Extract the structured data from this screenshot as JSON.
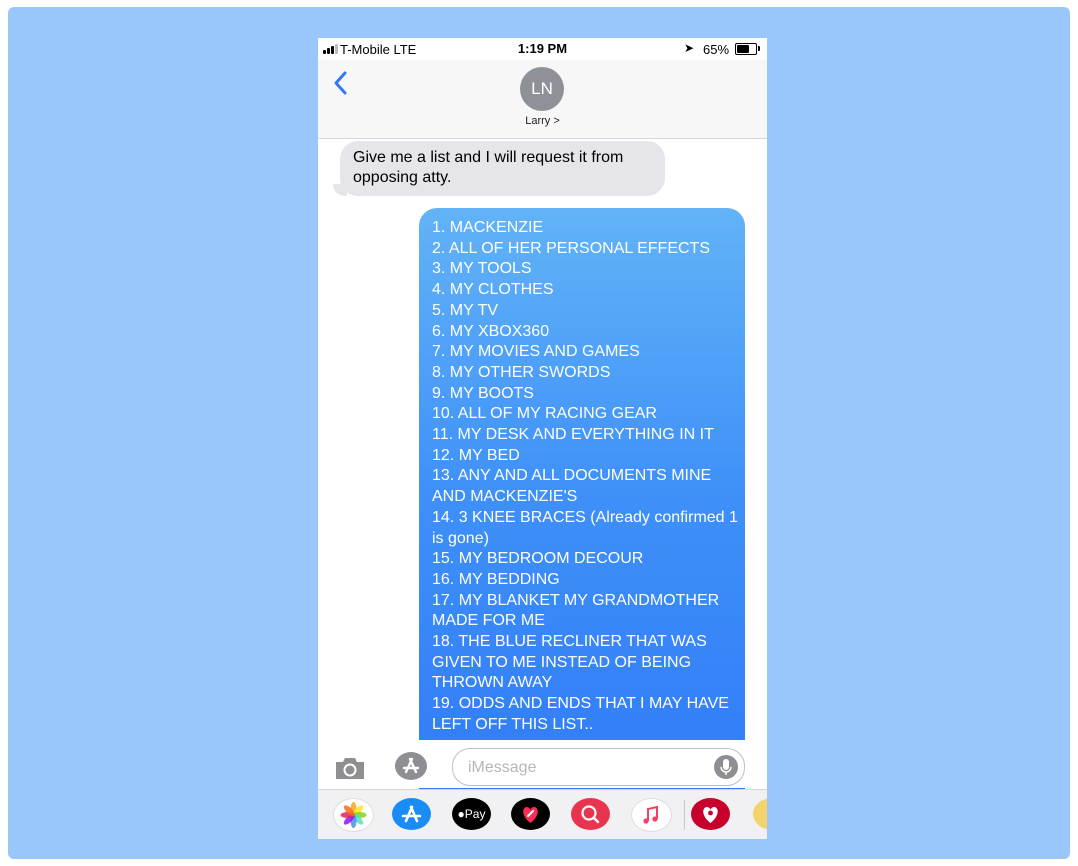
{
  "status_bar": {
    "carrier": "T-Mobile  LTE",
    "time": "1:19 PM",
    "battery": "65%"
  },
  "header": {
    "avatar_initials": "LN",
    "contact_name": "Larry >"
  },
  "messages": {
    "incoming": "Give me a list and I will request it from opposing atty.",
    "outgoing_lines": [
      "1. MACKENZIE",
      "2. ALL OF HER PERSONAL EFFECTS",
      "3. MY TOOLS",
      "4. MY CLOTHES",
      "5. MY TV",
      "6. MY XBOX360",
      "7. MY MOVIES AND GAMES",
      "8. MY OTHER SWORDS",
      "9. MY BOOTS",
      "10. ALL OF MY RACING GEAR",
      "11. MY DESK AND EVERYTHING IN IT",
      "12. MY BED",
      "13. ANY AND ALL DOCUMENTS MINE AND MACKENZIE'S",
      "14. 3 KNEE BRACES (Already confirmed 1 is gone)",
      "15. MY BEDROOM DECOUR",
      "16. MY BEDDING",
      "17. MY BLANKET MY GRANDMOTHER MADE FOR ME",
      "18. THE BLUE RECLINER THAT WAS GIVEN TO ME INSTEAD OF BEING THROWN AWAY",
      "19. ODDS AND ENDS THAT I MAY HAVE LEFT OFF THIS LIST.."
    ]
  },
  "compose": {
    "placeholder": "iMessage"
  },
  "app_drawer": {
    "apps": [
      "photos-icon",
      "app-store-icon",
      "apple-pay-icon",
      "digital-touch-icon",
      "search-images-icon",
      "music-icon",
      "iheartradio-icon",
      "more-app-icon"
    ],
    "apple_pay_label": "Pay"
  },
  "colors": {
    "backdrop": "#99c6fb",
    "outgoing_top": "#62b3f7",
    "outgoing_bottom": "#2f78f7",
    "incoming": "#e5e5ea",
    "ios_blue": "#3478f6"
  }
}
